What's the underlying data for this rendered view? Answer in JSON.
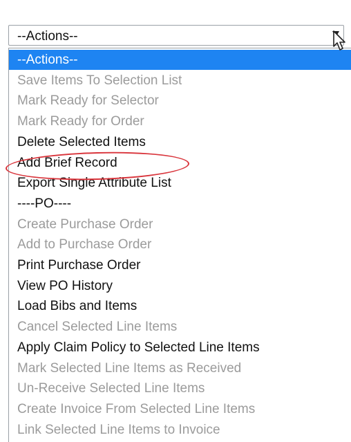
{
  "select": {
    "value": "--Actions--"
  },
  "dropdown": {
    "options": [
      {
        "label": "--Actions--",
        "state": "selected"
      },
      {
        "label": "Save Items To Selection List",
        "state": "disabled"
      },
      {
        "label": "Mark Ready for Selector",
        "state": "disabled"
      },
      {
        "label": "Mark Ready for Order",
        "state": "disabled"
      },
      {
        "label": "Delete Selected Items",
        "state": "enabled"
      },
      {
        "label": "Add Brief Record",
        "state": "enabled"
      },
      {
        "label": "Export Single Attribute List",
        "state": "enabled"
      },
      {
        "label": "----PO----",
        "state": "enabled"
      },
      {
        "label": "Create Purchase Order",
        "state": "disabled"
      },
      {
        "label": "Add to Purchase Order",
        "state": "disabled"
      },
      {
        "label": "Print Purchase Order",
        "state": "enabled"
      },
      {
        "label": "View PO History",
        "state": "enabled"
      },
      {
        "label": "Load Bibs and Items",
        "state": "enabled"
      },
      {
        "label": "Cancel Selected Line Items",
        "state": "disabled"
      },
      {
        "label": "Apply Claim Policy to Selected Line Items",
        "state": "enabled"
      },
      {
        "label": "Mark Selected Line Items as Received",
        "state": "disabled"
      },
      {
        "label": "Un-Receive Selected Line Items",
        "state": "disabled"
      },
      {
        "label": "Create Invoice From Selected Line Items",
        "state": "disabled"
      },
      {
        "label": "Link Selected Line Items to Invoice",
        "state": "disabled"
      }
    ]
  },
  "colors": {
    "selected_bg": "#1e84f2",
    "disabled_text": "#9b9b9b",
    "annotation": "#d9343b"
  },
  "icons": {
    "cursor": "mouse-pointer-icon",
    "arrow": "chevron-down-icon"
  }
}
